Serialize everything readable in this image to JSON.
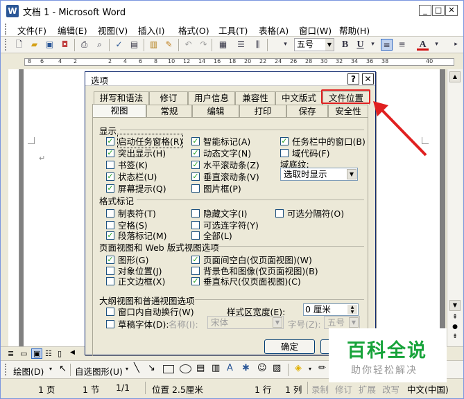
{
  "window": {
    "title": "文档 1 - Microsoft Word",
    "minimize_label": "_",
    "maximize_label": "□",
    "close_label": "✕"
  },
  "menu": [
    "文件(F)",
    "编辑(E)",
    "视图(V)",
    "插入(I)",
    "格式(O)",
    "工具(T)",
    "表格(A)",
    "窗口(W)",
    "帮助(H)"
  ],
  "toolbar": {
    "font_size": "五号",
    "bold": "B",
    "underline": "U",
    "font_color_label": "A"
  },
  "ruler": [
    "8",
    "6",
    "4",
    "2",
    "2",
    "4",
    "6",
    "8",
    "10",
    "12",
    "14",
    "16",
    "18",
    "20",
    "22",
    "24",
    "26",
    "28",
    "30",
    "32",
    "34",
    "36",
    "38",
    "40"
  ],
  "dialog": {
    "title": "选项",
    "help_label": "?",
    "close_label": "✕",
    "tabs_row1": [
      "拼写和语法",
      "修订",
      "用户信息",
      "兼容性",
      "中文版式",
      "文件位置"
    ],
    "tabs_row2": [
      "视图",
      "常规",
      "编辑",
      "打印",
      "保存",
      "安全性"
    ],
    "show": {
      "label": "显示",
      "col1": [
        {
          "label": "启动任务窗格(R)",
          "checked": true
        },
        {
          "label": "突出显示(H)",
          "checked": true
        },
        {
          "label": "书签(K)",
          "checked": false
        },
        {
          "label": "状态栏(U)",
          "checked": true
        },
        {
          "label": "屏幕提示(Q)",
          "checked": true
        }
      ],
      "col2": [
        {
          "label": "智能标记(A)",
          "checked": true
        },
        {
          "label": "动态文字(N)",
          "checked": true
        },
        {
          "label": "水平滚动条(Z)",
          "checked": true
        },
        {
          "label": "垂直滚动条(V)",
          "checked": true
        },
        {
          "label": "图片框(P)",
          "checked": false
        }
      ],
      "col3": [
        {
          "label": "任务栏中的窗口(B)",
          "checked": true
        },
        {
          "label": "域代码(F)",
          "checked": false
        }
      ],
      "field_shading_label": "域底纹:",
      "field_shading_value": "选取时显示"
    },
    "format_marks": {
      "label": "格式标记",
      "col1": [
        {
          "label": "制表符(T)",
          "checked": false
        },
        {
          "label": "空格(S)",
          "checked": false
        },
        {
          "label": "段落标记(M)",
          "checked": true
        }
      ],
      "col2": [
        {
          "label": "隐藏文字(I)",
          "checked": false
        },
        {
          "label": "可选连字符(Y)",
          "checked": false
        },
        {
          "label": "全部(L)",
          "checked": false
        }
      ],
      "col3": [
        {
          "label": "可选分隔符(O)",
          "checked": false
        }
      ]
    },
    "print_web": {
      "label": "页面视图和 Web 版式视图选项",
      "col1": [
        {
          "label": "图形(G)",
          "checked": true
        },
        {
          "label": "对象位置(J)",
          "checked": false
        },
        {
          "label": "正文边框(X)",
          "checked": false
        }
      ],
      "col2": [
        {
          "label": "页面间空白(仅页面视图)(W)",
          "checked": true
        },
        {
          "label": "背景色和图像(仅页面视图)(B)",
          "checked": false
        },
        {
          "label": "垂直标尺(仅页面视图)(C)",
          "checked": true
        }
      ]
    },
    "outline": {
      "label": "大纲视图和普通视图选项",
      "wrap": {
        "label": "窗口内自动换行(W)",
        "checked": false
      },
      "draft": {
        "label": "草稿字体(D):",
        "checked": false
      },
      "style_area_label": "样式区宽度(E):",
      "style_area_value": "0 厘米",
      "name_label": "名称(I):",
      "name_value": "宋体",
      "size_label": "字号(Z):",
      "size_value": "五号"
    },
    "ok_label": "确定"
  },
  "drawbar": {
    "draw_label": "绘图(D)",
    "autoshapes_label": "自选图形(U)"
  },
  "status": {
    "page": "1 页",
    "section": "1 节",
    "pages": "1/1",
    "position": "位置 2.5厘米",
    "line": "1 行",
    "column": "1 列",
    "rec": "录制",
    "trk": "修订",
    "ext": "扩展",
    "ovr": "改写",
    "lang": "中文(中国)"
  },
  "watermark": {
    "title": "百科全说",
    "subtitle": "助你轻松解决"
  },
  "colors": {
    "accent_red": "#e02020",
    "check_green": "#21a121",
    "watermark_green": "#17a33a"
  }
}
